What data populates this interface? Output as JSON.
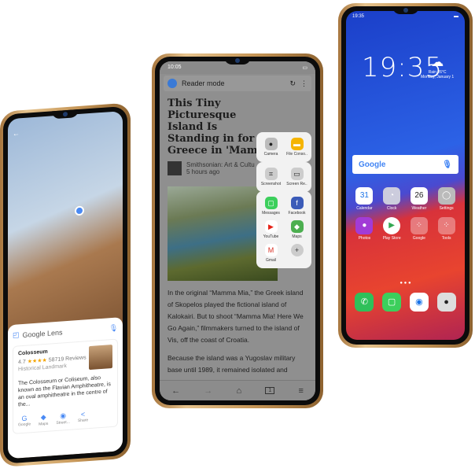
{
  "lens_phone": {
    "title": "Google Lens",
    "place": "Colosseum",
    "rating": "4.7",
    "stars": "★★★★",
    "reviews": "58719 Reviews",
    "category": "Historical Landmark",
    "description": "The Colosseum or Coliseum, also known as the Flavian Amphitheatre, is an oval amphitheatre in the centre of the...",
    "actions": [
      "Google",
      "Maps",
      "Street...",
      "Share"
    ]
  },
  "reader_phone": {
    "time": "10:05",
    "reader_label": "Reader mode",
    "headline": "This Tiny Picturesque Island Is Standing in for Greece in 'Mamm",
    "source": "Smithsonian: Art & Cultu",
    "age": "5 hours ago",
    "paragraphs": [
      "In the original “Mamma Mia,” the Greek island of Skopelos played the fictional island of Kalokairi. But to shoot “Mamma Mia! Here We Go Again,” filmmakers turned to the island of Vis, off the coast of Croatia.",
      "Because the island was a Yugoslav military base until 1989, it remained isolated and"
    ],
    "panel_top": [
      "Camera",
      "File Conso.."
    ],
    "panel_mid": [
      "Screenshot",
      "Screen Re.."
    ],
    "panel_apps": [
      "Messages",
      "Facebook",
      "YouTube",
      "Maps",
      "Gmail",
      ""
    ],
    "tab_count": "1"
  },
  "home_phone": {
    "status_time": "19:35",
    "clock": "19:35",
    "weather": "Rain 26°C",
    "date": "Monday, January 1",
    "search_logo": "Google",
    "apps": [
      "Calendar",
      "Clock",
      "Weather",
      "Settings",
      "Photos",
      "Play Store",
      "Google",
      "Tools"
    ],
    "calendar_day": "31",
    "weather_day": "26"
  }
}
